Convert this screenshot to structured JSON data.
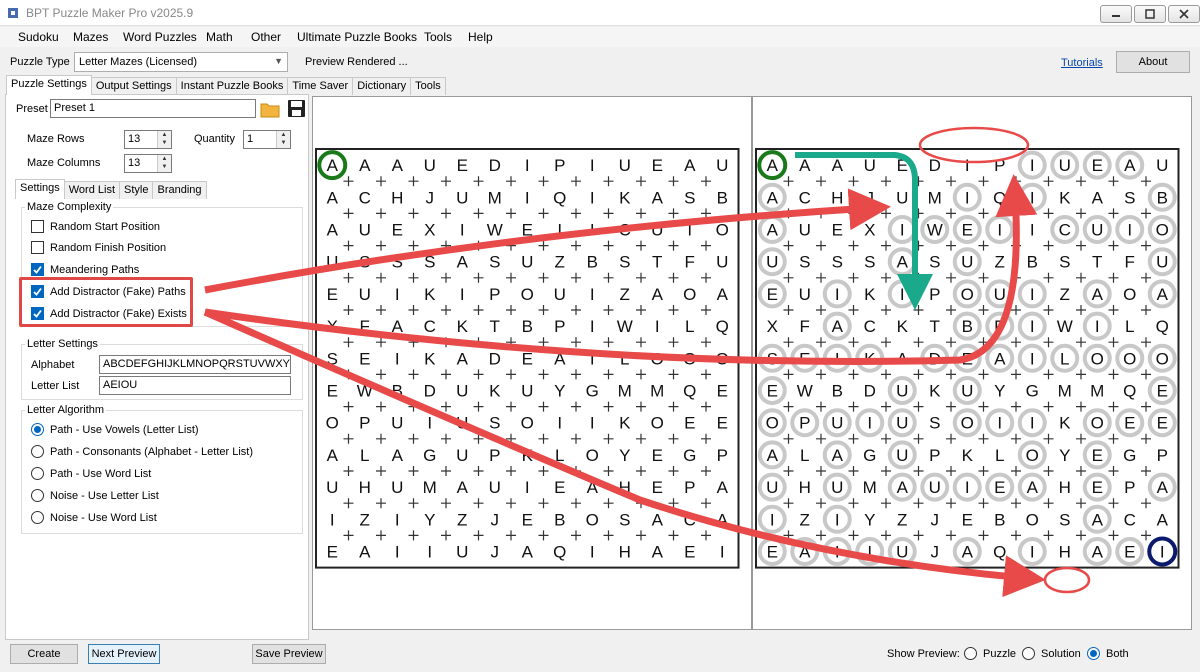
{
  "window": {
    "title": "BPT Puzzle Maker Pro v2025.9"
  },
  "menu": [
    "Sudoku",
    "Mazes",
    "Word Puzzles",
    "Math",
    "Other",
    "Ultimate Puzzle Books",
    "Tools",
    "Help"
  ],
  "toolbar": {
    "puzzle_type_label": "Puzzle Type",
    "puzzle_type_value": "Letter Mazes (Licensed)",
    "status": "Preview Rendered ...",
    "tutorials": "Tutorials",
    "about": "About"
  },
  "tabs": [
    "Puzzle Settings",
    "Output Settings",
    "Instant Puzzle Books",
    "Time Saver",
    "Dictionary",
    "Tools"
  ],
  "settings": {
    "preset_label": "Preset",
    "preset_value": "Preset 1",
    "rows_label": "Maze Rows",
    "rows_value": "13",
    "cols_label": "Maze Columns",
    "cols_value": "13",
    "quantity_label": "Quantity",
    "quantity_value": "1",
    "subtabs": [
      "Settings",
      "Word List",
      "Style",
      "Branding"
    ],
    "complexity_title": "Maze Complexity",
    "checkboxes": [
      {
        "label": "Random Start Position",
        "checked": false
      },
      {
        "label": "Random Finish Position",
        "checked": false
      },
      {
        "label": "Meandering Paths",
        "checked": true
      },
      {
        "label": "Add Distractor (Fake) Paths",
        "checked": true
      },
      {
        "label": "Add Distractor (Fake) Exists",
        "checked": true
      }
    ],
    "letter_title": "Letter Settings",
    "alphabet_label": "Alphabet",
    "alphabet_value": "ABCDEFGHIJKLMNOPQRSTUVWXYZ",
    "letterlist_label": "Letter List",
    "letterlist_value": "AEIOU",
    "algorithm_title": "Letter Algorithm",
    "radios": [
      {
        "label": "Path - Use Vowels (Letter List)",
        "checked": true
      },
      {
        "label": "Path - Consonants (Alphabet - Letter List)",
        "checked": false
      },
      {
        "label": "Path - Use Word List",
        "checked": false
      },
      {
        "label": "Noise - Use Letter List",
        "checked": false
      },
      {
        "label": "Noise - Use Word List",
        "checked": false
      }
    ]
  },
  "maze": {
    "rows": [
      "AAAUEDIPIUEAU",
      "ACHJUMIQIKASB",
      "AUEXIWEIICUIO",
      "USSSASUZBSTFU",
      "EUIKIPOUIZAOA",
      "XFACKTBPIWILQ",
      "SEIKADEAILOOO",
      "EWBDUKUYGMMQE",
      "OPUIUSOIIKOEE",
      "ALAGUPKLOYEGP",
      "UHUMAUIEAHEPA",
      "IZIYZJEBOSACA",
      "EAIIUJAQIHAEI"
    ],
    "start_color": "#1a7a1a",
    "finish_color": "#0c1a6e",
    "solution_color": "#c8c8c8",
    "annotation_color": "#e84a4a",
    "route_color": "#1aa98a"
  },
  "bottom": {
    "create": "Create",
    "next_preview": "Next Preview",
    "save_preview": "Save Preview",
    "show_preview_label": "Show Preview:",
    "options": [
      {
        "label": "Puzzle",
        "checked": false
      },
      {
        "label": "Solution",
        "checked": false
      },
      {
        "label": "Both",
        "checked": true
      }
    ]
  }
}
